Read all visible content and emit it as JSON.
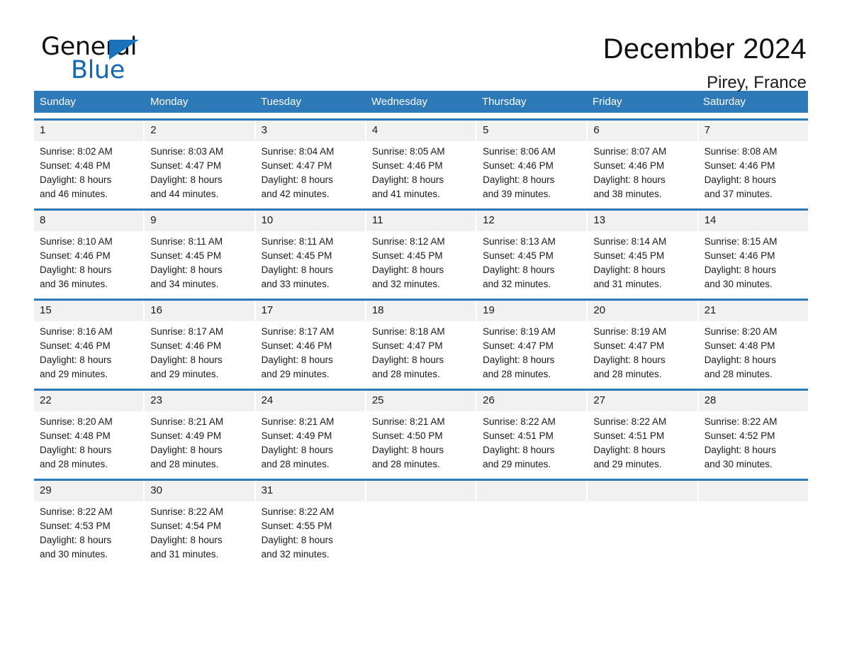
{
  "brand": {
    "name_top": "General",
    "name_bottom": "Blue",
    "triangle_icon": "blue-triangle-icon",
    "accent_color": "#1268b3"
  },
  "header": {
    "month_title": "December 2024",
    "location": "Pirey, France",
    "header_bg_color": "#2e7ab8",
    "row_border_color": "#2e7ab8",
    "date_band_color": "#f1f1f1"
  },
  "weekdays": [
    "Sunday",
    "Monday",
    "Tuesday",
    "Wednesday",
    "Thursday",
    "Friday",
    "Saturday"
  ],
  "weeks": [
    [
      {
        "day": "1",
        "sunrise": "Sunrise: 8:02 AM",
        "sunset": "Sunset: 4:48 PM",
        "daylight_line1": "Daylight: 8 hours",
        "daylight_line2": "and 46 minutes."
      },
      {
        "day": "2",
        "sunrise": "Sunrise: 8:03 AM",
        "sunset": "Sunset: 4:47 PM",
        "daylight_line1": "Daylight: 8 hours",
        "daylight_line2": "and 44 minutes."
      },
      {
        "day": "3",
        "sunrise": "Sunrise: 8:04 AM",
        "sunset": "Sunset: 4:47 PM",
        "daylight_line1": "Daylight: 8 hours",
        "daylight_line2": "and 42 minutes."
      },
      {
        "day": "4",
        "sunrise": "Sunrise: 8:05 AM",
        "sunset": "Sunset: 4:46 PM",
        "daylight_line1": "Daylight: 8 hours",
        "daylight_line2": "and 41 minutes."
      },
      {
        "day": "5",
        "sunrise": "Sunrise: 8:06 AM",
        "sunset": "Sunset: 4:46 PM",
        "daylight_line1": "Daylight: 8 hours",
        "daylight_line2": "and 39 minutes."
      },
      {
        "day": "6",
        "sunrise": "Sunrise: 8:07 AM",
        "sunset": "Sunset: 4:46 PM",
        "daylight_line1": "Daylight: 8 hours",
        "daylight_line2": "and 38 minutes."
      },
      {
        "day": "7",
        "sunrise": "Sunrise: 8:08 AM",
        "sunset": "Sunset: 4:46 PM",
        "daylight_line1": "Daylight: 8 hours",
        "daylight_line2": "and 37 minutes."
      }
    ],
    [
      {
        "day": "8",
        "sunrise": "Sunrise: 8:10 AM",
        "sunset": "Sunset: 4:46 PM",
        "daylight_line1": "Daylight: 8 hours",
        "daylight_line2": "and 36 minutes."
      },
      {
        "day": "9",
        "sunrise": "Sunrise: 8:11 AM",
        "sunset": "Sunset: 4:45 PM",
        "daylight_line1": "Daylight: 8 hours",
        "daylight_line2": "and 34 minutes."
      },
      {
        "day": "10",
        "sunrise": "Sunrise: 8:11 AM",
        "sunset": "Sunset: 4:45 PM",
        "daylight_line1": "Daylight: 8 hours",
        "daylight_line2": "and 33 minutes."
      },
      {
        "day": "11",
        "sunrise": "Sunrise: 8:12 AM",
        "sunset": "Sunset: 4:45 PM",
        "daylight_line1": "Daylight: 8 hours",
        "daylight_line2": "and 32 minutes."
      },
      {
        "day": "12",
        "sunrise": "Sunrise: 8:13 AM",
        "sunset": "Sunset: 4:45 PM",
        "daylight_line1": "Daylight: 8 hours",
        "daylight_line2": "and 32 minutes."
      },
      {
        "day": "13",
        "sunrise": "Sunrise: 8:14 AM",
        "sunset": "Sunset: 4:45 PM",
        "daylight_line1": "Daylight: 8 hours",
        "daylight_line2": "and 31 minutes."
      },
      {
        "day": "14",
        "sunrise": "Sunrise: 8:15 AM",
        "sunset": "Sunset: 4:46 PM",
        "daylight_line1": "Daylight: 8 hours",
        "daylight_line2": "and 30 minutes."
      }
    ],
    [
      {
        "day": "15",
        "sunrise": "Sunrise: 8:16 AM",
        "sunset": "Sunset: 4:46 PM",
        "daylight_line1": "Daylight: 8 hours",
        "daylight_line2": "and 29 minutes."
      },
      {
        "day": "16",
        "sunrise": "Sunrise: 8:17 AM",
        "sunset": "Sunset: 4:46 PM",
        "daylight_line1": "Daylight: 8 hours",
        "daylight_line2": "and 29 minutes."
      },
      {
        "day": "17",
        "sunrise": "Sunrise: 8:17 AM",
        "sunset": "Sunset: 4:46 PM",
        "daylight_line1": "Daylight: 8 hours",
        "daylight_line2": "and 29 minutes."
      },
      {
        "day": "18",
        "sunrise": "Sunrise: 8:18 AM",
        "sunset": "Sunset: 4:47 PM",
        "daylight_line1": "Daylight: 8 hours",
        "daylight_line2": "and 28 minutes."
      },
      {
        "day": "19",
        "sunrise": "Sunrise: 8:19 AM",
        "sunset": "Sunset: 4:47 PM",
        "daylight_line1": "Daylight: 8 hours",
        "daylight_line2": "and 28 minutes."
      },
      {
        "day": "20",
        "sunrise": "Sunrise: 8:19 AM",
        "sunset": "Sunset: 4:47 PM",
        "daylight_line1": "Daylight: 8 hours",
        "daylight_line2": "and 28 minutes."
      },
      {
        "day": "21",
        "sunrise": "Sunrise: 8:20 AM",
        "sunset": "Sunset: 4:48 PM",
        "daylight_line1": "Daylight: 8 hours",
        "daylight_line2": "and 28 minutes."
      }
    ],
    [
      {
        "day": "22",
        "sunrise": "Sunrise: 8:20 AM",
        "sunset": "Sunset: 4:48 PM",
        "daylight_line1": "Daylight: 8 hours",
        "daylight_line2": "and 28 minutes."
      },
      {
        "day": "23",
        "sunrise": "Sunrise: 8:21 AM",
        "sunset": "Sunset: 4:49 PM",
        "daylight_line1": "Daylight: 8 hours",
        "daylight_line2": "and 28 minutes."
      },
      {
        "day": "24",
        "sunrise": "Sunrise: 8:21 AM",
        "sunset": "Sunset: 4:49 PM",
        "daylight_line1": "Daylight: 8 hours",
        "daylight_line2": "and 28 minutes."
      },
      {
        "day": "25",
        "sunrise": "Sunrise: 8:21 AM",
        "sunset": "Sunset: 4:50 PM",
        "daylight_line1": "Daylight: 8 hours",
        "daylight_line2": "and 28 minutes."
      },
      {
        "day": "26",
        "sunrise": "Sunrise: 8:22 AM",
        "sunset": "Sunset: 4:51 PM",
        "daylight_line1": "Daylight: 8 hours",
        "daylight_line2": "and 29 minutes."
      },
      {
        "day": "27",
        "sunrise": "Sunrise: 8:22 AM",
        "sunset": "Sunset: 4:51 PM",
        "daylight_line1": "Daylight: 8 hours",
        "daylight_line2": "and 29 minutes."
      },
      {
        "day": "28",
        "sunrise": "Sunrise: 8:22 AM",
        "sunset": "Sunset: 4:52 PM",
        "daylight_line1": "Daylight: 8 hours",
        "daylight_line2": "and 30 minutes."
      }
    ],
    [
      {
        "day": "29",
        "sunrise": "Sunrise: 8:22 AM",
        "sunset": "Sunset: 4:53 PM",
        "daylight_line1": "Daylight: 8 hours",
        "daylight_line2": "and 30 minutes."
      },
      {
        "day": "30",
        "sunrise": "Sunrise: 8:22 AM",
        "sunset": "Sunset: 4:54 PM",
        "daylight_line1": "Daylight: 8 hours",
        "daylight_line2": "and 31 minutes."
      },
      {
        "day": "31",
        "sunrise": "Sunrise: 8:22 AM",
        "sunset": "Sunset: 4:55 PM",
        "daylight_line1": "Daylight: 8 hours",
        "daylight_line2": "and 32 minutes."
      },
      {
        "day": "",
        "sunrise": "",
        "sunset": "",
        "daylight_line1": "",
        "daylight_line2": ""
      },
      {
        "day": "",
        "sunrise": "",
        "sunset": "",
        "daylight_line1": "",
        "daylight_line2": ""
      },
      {
        "day": "",
        "sunrise": "",
        "sunset": "",
        "daylight_line1": "",
        "daylight_line2": ""
      },
      {
        "day": "",
        "sunrise": "",
        "sunset": "",
        "daylight_line1": "",
        "daylight_line2": ""
      }
    ]
  ]
}
